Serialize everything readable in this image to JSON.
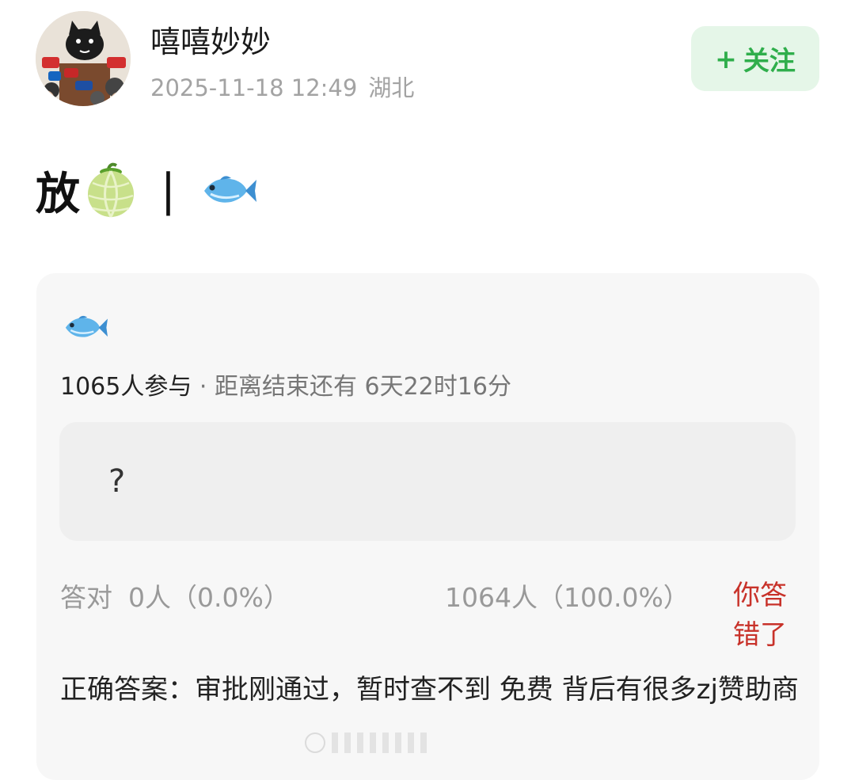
{
  "post": {
    "username": "嘻嘻妙妙",
    "timestamp": "2025-11-18 12:49",
    "location": "湖北",
    "follow_plus": "+",
    "follow_label": "关注",
    "title_text": "放",
    "title_divider": "|"
  },
  "quiz": {
    "participants": "1065人参与",
    "separator": " · ",
    "time_remaining": "距离结束还有 6天22时16分",
    "question_text": "?",
    "correct_label": "答对",
    "correct_stat": "0人（0.0%）",
    "wrong_stat": "1064人（100.0%）",
    "wrong_label": "你答错了",
    "answer_text": "正确答案：审批刚通过，暂时查不到 免费 背后有很多zj赞助商"
  },
  "colors": {
    "follow_text": "#2fae4b",
    "follow_bg": "#e5f6e8",
    "wrong": "#c8322a",
    "card_bg": "#f7f7f7"
  },
  "icons": [
    "avatar-image",
    "melon-emoji-icon",
    "fish-emoji-icon"
  ]
}
